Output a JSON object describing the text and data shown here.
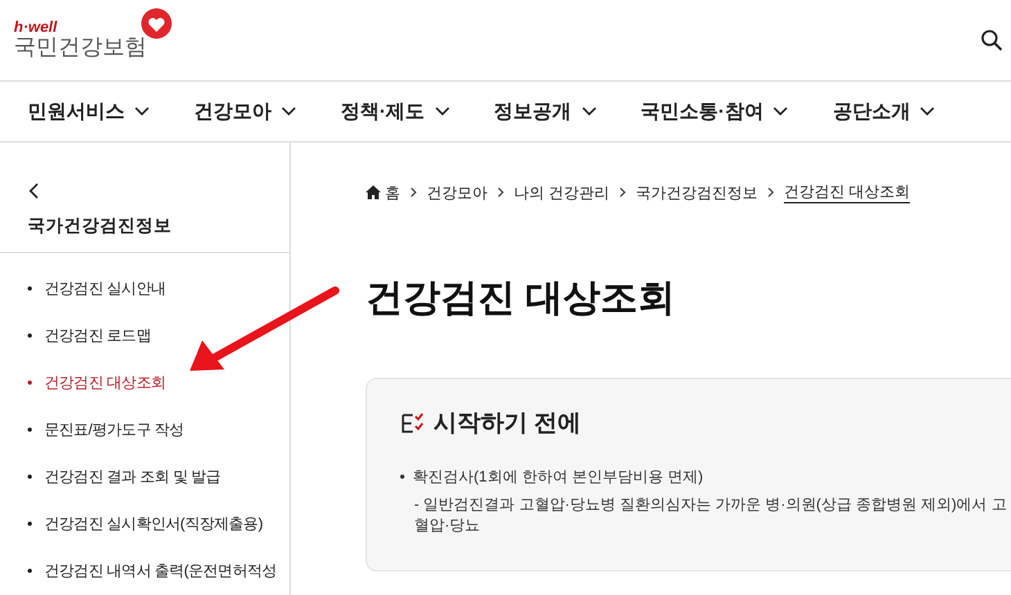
{
  "header": {
    "logo_tagline": "h·well",
    "logo_name": "국민건강보험"
  },
  "nav": [
    {
      "label": "민원서비스"
    },
    {
      "label": "건강모아"
    },
    {
      "label": "정책·제도"
    },
    {
      "label": "정보공개"
    },
    {
      "label": "국민소통·참여"
    },
    {
      "label": "공단소개"
    }
  ],
  "sidebar": {
    "title": "국가건강검진정보",
    "items": [
      {
        "label": "건강검진 실시안내",
        "selected": false
      },
      {
        "label": "건강검진 로드맵",
        "selected": false
      },
      {
        "label": "건강검진 대상조회",
        "selected": true
      },
      {
        "label": "문진표/평가도구 작성",
        "selected": false
      },
      {
        "label": "건강검진 결과 조회 및 발급",
        "selected": false
      },
      {
        "label": "건강검진 실시확인서(직장제출용)",
        "selected": false
      },
      {
        "label": "건강검진 내역서 출력(운전면허적성",
        "selected": false
      }
    ]
  },
  "breadcrumb": [
    {
      "label": "홈",
      "kind": "home"
    },
    {
      "label": "건강모아",
      "kind": "link"
    },
    {
      "label": "나의 건강관리",
      "kind": "link"
    },
    {
      "label": "국가건강검진정보",
      "kind": "link"
    },
    {
      "label": "건강검진 대상조회",
      "kind": "current"
    }
  ],
  "page_title": "건강검진 대상조회",
  "card": {
    "title": "시작하기 전에",
    "items": [
      {
        "kind": "bullet",
        "text": "확진검사(1회에 한하여 본인부담비용 면제)"
      },
      {
        "kind": "sub",
        "text": "- 일반검진결과 고혈압·당뇨병 질환의심자는 가까운 병·의원(상급 종합병원 제외)에서 고혈압·당뇨"
      }
    ]
  }
}
